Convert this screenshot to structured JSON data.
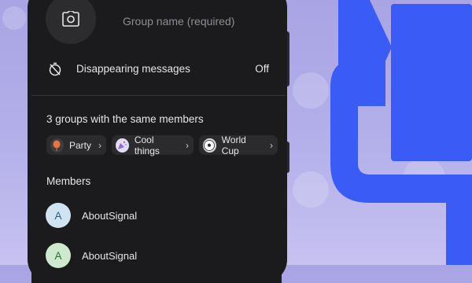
{
  "group": {
    "name_placeholder": "Group name (required)",
    "avatar_icon": "camera-icon"
  },
  "settings": {
    "disappearing_label": "Disappearing messages",
    "disappearing_value": "Off",
    "disappearing_icon": "timer-off-icon"
  },
  "shared_groups": {
    "title": "3 groups with the same members",
    "chips": [
      {
        "label": "Party",
        "icon": "balloon-icon",
        "icon_color": "#e8743b"
      },
      {
        "label": "Cool things",
        "icon": "party-popper-icon",
        "icon_color": "#b9a4e8"
      },
      {
        "label": "World Cup",
        "icon": "soccer-ball-icon",
        "icon_color": "#ffffff"
      }
    ]
  },
  "members": {
    "title": "Members",
    "list": [
      {
        "initial": "A",
        "name": "AboutSignal",
        "avatar_bg": "#cfe3f1",
        "avatar_fg": "#2a5e86"
      },
      {
        "initial": "A",
        "name": "AboutSignal",
        "avatar_bg": "#cfe9cf",
        "avatar_fg": "#2c6e2c"
      }
    ]
  },
  "colors": {
    "brand_blue": "#3a5bf5",
    "screen_bg": "#1b1b1d",
    "background": "#b4b0ea"
  }
}
